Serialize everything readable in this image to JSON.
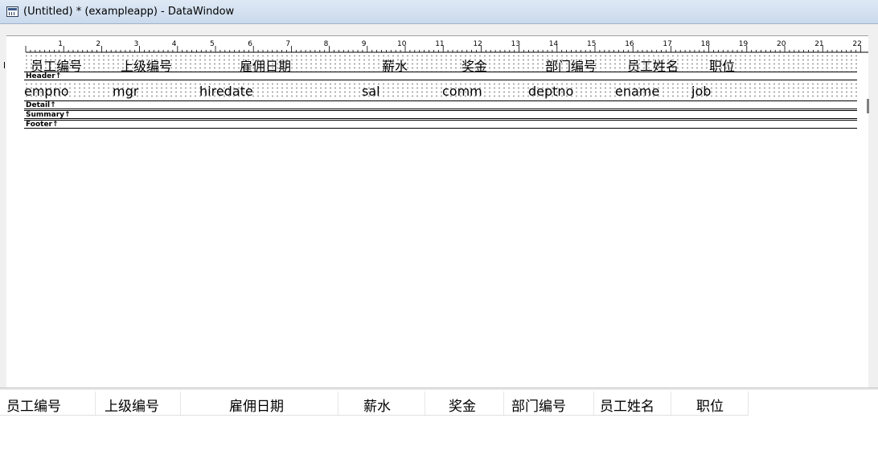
{
  "window": {
    "title": "(Untitled) * (exampleapp) - DataWindow",
    "icon": "datawindow-icon"
  },
  "ruler": {
    "ticks": [
      "1",
      "2",
      "3",
      "4",
      "5",
      "6",
      "7",
      "8",
      "9",
      "10",
      "11",
      "12",
      "13",
      "14",
      "15",
      "16",
      "17",
      "18",
      "19",
      "20",
      "21",
      "22"
    ]
  },
  "header_band": {
    "label": "Header↑",
    "columns": [
      "员工编号",
      "上级编号",
      "雇佣日期",
      "薪水",
      "奖金",
      "部门编号",
      "员工姓名",
      "职位"
    ]
  },
  "detail_band": {
    "label": "Detail↑",
    "fields": [
      "empno",
      "mgr",
      "hiredate",
      "sal",
      "comm",
      "deptno",
      "ename",
      "job"
    ]
  },
  "summary_band": {
    "label": "Summary↑"
  },
  "footer_band": {
    "label": "Footer↑"
  },
  "preview": {
    "columns": [
      "员工编号",
      "上级编号",
      "雇佣日期",
      "薪水",
      "奖金",
      "部门编号",
      "员工姓名",
      "职位"
    ]
  }
}
